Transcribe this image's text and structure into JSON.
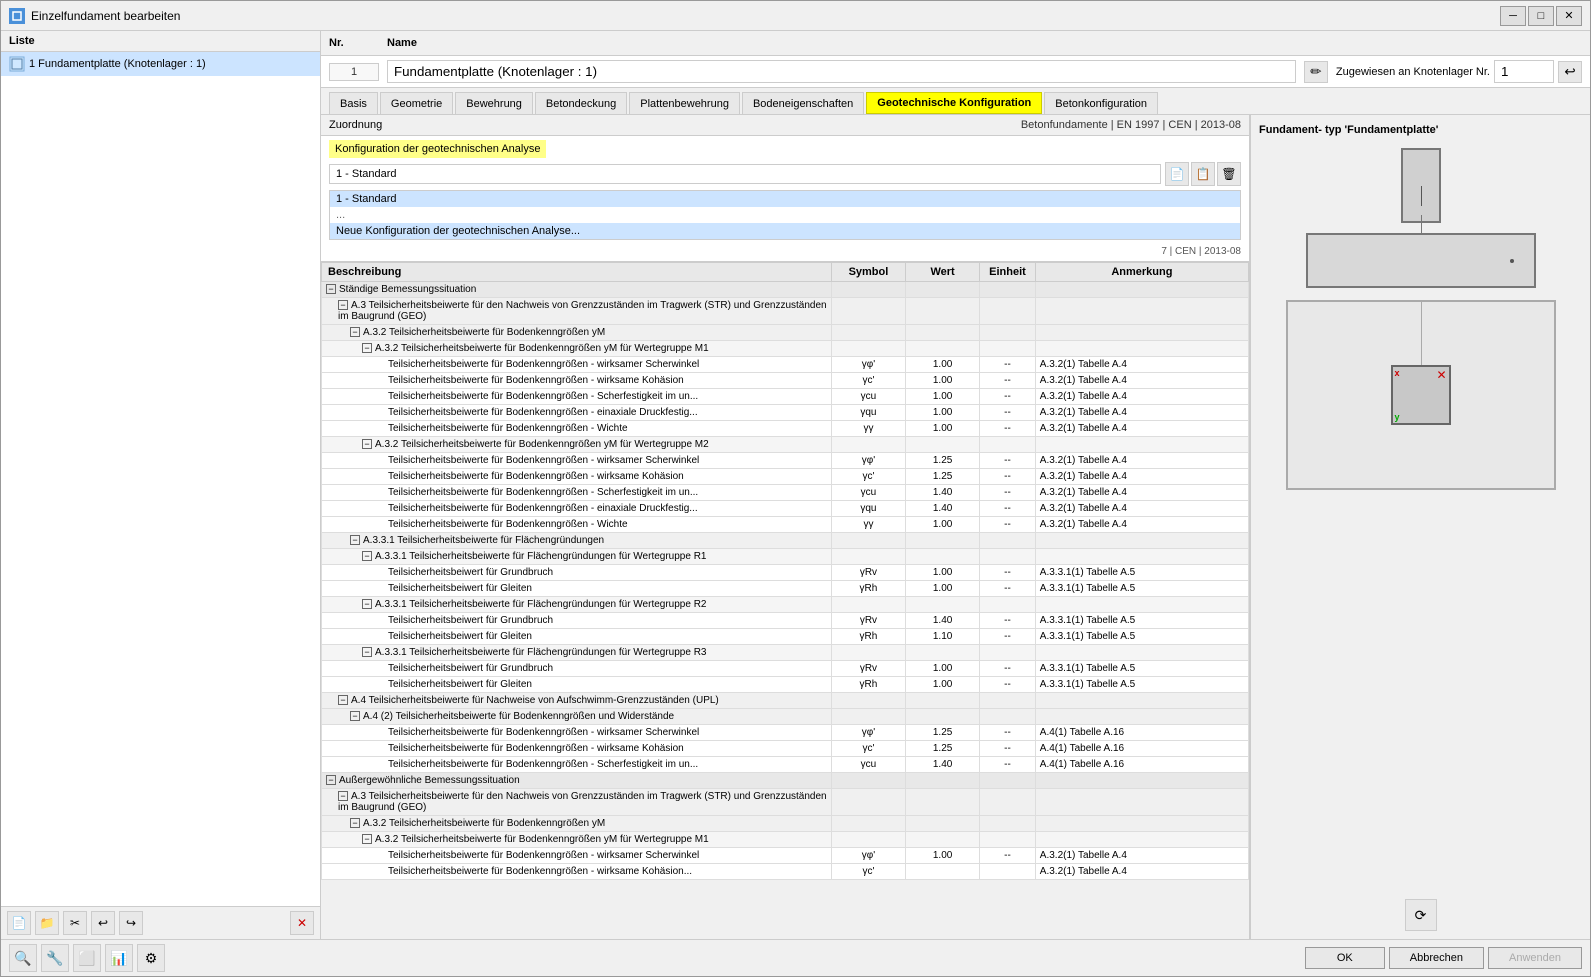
{
  "window": {
    "title": "Einzelfundament bearbeiten",
    "minimize_label": "─",
    "maximize_label": "□",
    "close_label": "✕"
  },
  "left_panel": {
    "header": "Liste",
    "items": [
      {
        "id": 1,
        "label": "1  Fundamentplatte (Knotenlager : 1)"
      }
    ],
    "footer_btns": [
      "📄",
      "📁",
      "✂",
      "↩",
      "↪"
    ],
    "delete_btn": "✕"
  },
  "header": {
    "nr_label": "Nr.",
    "name_label": "Name",
    "nr_value": "1",
    "name_value": "Fundamentplatte (Knotenlager : 1)"
  },
  "assignment": {
    "label": "Zugewiesen an Knotenlager Nr.",
    "value": "1"
  },
  "tabs": [
    {
      "id": "basis",
      "label": "Basis",
      "active": false,
      "highlight": false
    },
    {
      "id": "geometrie",
      "label": "Geometrie",
      "active": false,
      "highlight": false
    },
    {
      "id": "bewehrung",
      "label": "Bewehrung",
      "active": false,
      "highlight": false
    },
    {
      "id": "betondeckung",
      "label": "Betondeckung",
      "active": false,
      "highlight": false
    },
    {
      "id": "plattenbewehrung",
      "label": "Plattenbewehrung",
      "active": false,
      "highlight": false
    },
    {
      "id": "bodeneigenschaften",
      "label": "Bodeneigenschaften",
      "active": false,
      "highlight": false
    },
    {
      "id": "geotechnische",
      "label": "Geotechnische Konfiguration",
      "active": true,
      "highlight": true
    },
    {
      "id": "betonkonfiguration",
      "label": "Betonkonfiguration",
      "active": false,
      "highlight": false
    }
  ],
  "zuordnung": {
    "label": "Zuordnung",
    "norm_text": "Betonfundamente | EN 1997 | CEN | 2013-08"
  },
  "config": {
    "header_label": "Konfiguration der geotechnischen Analyse",
    "selected": "1 - Standard",
    "items": [
      {
        "label": "1 - Standard",
        "selected": true
      },
      {
        "label": "Neue Konfiguration der geotechnischen Analyse...",
        "is_new": true
      }
    ],
    "dots": "...",
    "norm_value": "7 | CEN | 2013-08"
  },
  "table": {
    "columns": [
      "Beschreibung",
      "Symbol",
      "Wert",
      "Einheit",
      "Anmerkung"
    ],
    "rows": [
      {
        "level": 0,
        "expand": true,
        "text": "Ständige Bemessungssituation",
        "symbol": "",
        "wert": "",
        "einheit": "",
        "anmerkung": "",
        "type": "section"
      },
      {
        "level": 1,
        "expand": true,
        "text": "A.3 Teilsicherheitsbeiwerte für den Nachweis von Grenzzuständen im Tragwerk (STR) und Grenzzuständen im Baugrund (GEO)",
        "symbol": "",
        "wert": "",
        "einheit": "",
        "anmerkung": "",
        "type": "sub"
      },
      {
        "level": 2,
        "expand": true,
        "text": "A.3.2 Teilsicherheitsbeiwerte für Bodenkenngrößen yM",
        "symbol": "",
        "wert": "",
        "einheit": "",
        "anmerkung": "",
        "type": "sub"
      },
      {
        "level": 3,
        "expand": true,
        "text": "A.3.2 Teilsicherheitsbeiwerte für Bodenkenngrößen yM für Wertegruppe M1",
        "symbol": "",
        "wert": "",
        "einheit": "",
        "anmerkung": "",
        "type": "sub"
      },
      {
        "level": 4,
        "expand": false,
        "text": "Teilsicherheitsbeiwerte für Bodenkenngrößen - wirksamer Scherwinkel",
        "symbol": "γφ'",
        "wert": "1.00",
        "einheit": "--",
        "anmerkung": "A.3.2(1) Tabelle A.4",
        "type": "data"
      },
      {
        "level": 4,
        "expand": false,
        "text": "Teilsicherheitsbeiwerte für Bodenkenngrößen - wirksame Kohäsion",
        "symbol": "γc'",
        "wert": "1.00",
        "einheit": "--",
        "anmerkung": "A.3.2(1) Tabelle A.4",
        "type": "data"
      },
      {
        "level": 4,
        "expand": false,
        "text": "Teilsicherheitsbeiwerte für Bodenkenngrößen - Scherfestigkeit im un...",
        "symbol": "γcu",
        "wert": "1.00",
        "einheit": "--",
        "anmerkung": "A.3.2(1) Tabelle A.4",
        "type": "data"
      },
      {
        "level": 4,
        "expand": false,
        "text": "Teilsicherheitsbeiwerte für Bodenkenngrößen - einaxiale Druckfestig...",
        "symbol": "γqu",
        "wert": "1.00",
        "einheit": "--",
        "anmerkung": "A.3.2(1) Tabelle A.4",
        "type": "data"
      },
      {
        "level": 4,
        "expand": false,
        "text": "Teilsicherheitsbeiwerte für Bodenkenngrößen - Wichte",
        "symbol": "γγ",
        "wert": "1.00",
        "einheit": "--",
        "anmerkung": "A.3.2(1) Tabelle A.4",
        "type": "data"
      },
      {
        "level": 3,
        "expand": true,
        "text": "A.3.2 Teilsicherheitsbeiwerte für Bodenkenngrößen yM für Wertegruppe M2",
        "symbol": "",
        "wert": "",
        "einheit": "",
        "anmerkung": "",
        "type": "sub"
      },
      {
        "level": 4,
        "expand": false,
        "text": "Teilsicherheitsbeiwerte für Bodenkenngrößen - wirksamer Scherwinkel",
        "symbol": "γφ'",
        "wert": "1.25",
        "einheit": "--",
        "anmerkung": "A.3.2(1) Tabelle A.4",
        "type": "data"
      },
      {
        "level": 4,
        "expand": false,
        "text": "Teilsicherheitsbeiwerte für Bodenkenngrößen - wirksame Kohäsion",
        "symbol": "γc'",
        "wert": "1.25",
        "einheit": "--",
        "anmerkung": "A.3.2(1) Tabelle A.4",
        "type": "data"
      },
      {
        "level": 4,
        "expand": false,
        "text": "Teilsicherheitsbeiwerte für Bodenkenngrößen - Scherfestigkeit im un...",
        "symbol": "γcu",
        "wert": "1.40",
        "einheit": "--",
        "anmerkung": "A.3.2(1) Tabelle A.4",
        "type": "data"
      },
      {
        "level": 4,
        "expand": false,
        "text": "Teilsicherheitsbeiwerte für Bodenkenngrößen - einaxiale Druckfestig...",
        "symbol": "γqu",
        "wert": "1.40",
        "einheit": "--",
        "anmerkung": "A.3.2(1) Tabelle A.4",
        "type": "data"
      },
      {
        "level": 4,
        "expand": false,
        "text": "Teilsicherheitsbeiwerte für Bodenkenngrößen - Wichte",
        "symbol": "γγ",
        "wert": "1.00",
        "einheit": "--",
        "anmerkung": "A.3.2(1) Tabelle A.4",
        "type": "data"
      },
      {
        "level": 2,
        "expand": true,
        "text": "A.3.3.1 Teilsicherheitsbeiwerte für Flächengründungen",
        "symbol": "",
        "wert": "",
        "einheit": "",
        "anmerkung": "",
        "type": "sub"
      },
      {
        "level": 3,
        "expand": true,
        "text": "A.3.3.1 Teilsicherheitsbeiwerte für Flächengründungen für Wertegruppe R1",
        "symbol": "",
        "wert": "",
        "einheit": "",
        "anmerkung": "",
        "type": "sub"
      },
      {
        "level": 4,
        "expand": false,
        "text": "Teilsicherheitsbeiwert für Grundbruch",
        "symbol": "γRv",
        "wert": "1.00",
        "einheit": "--",
        "anmerkung": "A.3.3.1(1) Tabelle A.5",
        "type": "data"
      },
      {
        "level": 4,
        "expand": false,
        "text": "Teilsicherheitsbeiwert für Gleiten",
        "symbol": "γRh",
        "wert": "1.00",
        "einheit": "--",
        "anmerkung": "A.3.3.1(1) Tabelle A.5",
        "type": "data"
      },
      {
        "level": 3,
        "expand": true,
        "text": "A.3.3.1 Teilsicherheitsbeiwerte für Flächengründungen für Wertegruppe R2",
        "symbol": "",
        "wert": "",
        "einheit": "",
        "anmerkung": "",
        "type": "sub"
      },
      {
        "level": 4,
        "expand": false,
        "text": "Teilsicherheitsbeiwert für Grundbruch",
        "symbol": "γRv",
        "wert": "1.40",
        "einheit": "--",
        "anmerkung": "A.3.3.1(1) Tabelle A.5",
        "type": "data"
      },
      {
        "level": 4,
        "expand": false,
        "text": "Teilsicherheitsbeiwert für Gleiten",
        "symbol": "γRh",
        "wert": "1.10",
        "einheit": "--",
        "anmerkung": "A.3.3.1(1) Tabelle A.5",
        "type": "data"
      },
      {
        "level": 3,
        "expand": true,
        "text": "A.3.3.1 Teilsicherheitsbeiwerte für Flächengründungen für Wertegruppe R3",
        "symbol": "",
        "wert": "",
        "einheit": "",
        "anmerkung": "",
        "type": "sub"
      },
      {
        "level": 4,
        "expand": false,
        "text": "Teilsicherheitsbeiwert für Grundbruch",
        "symbol": "γRv",
        "wert": "1.00",
        "einheit": "--",
        "anmerkung": "A.3.3.1(1) Tabelle A.5",
        "type": "data"
      },
      {
        "level": 4,
        "expand": false,
        "text": "Teilsicherheitsbeiwert für Gleiten",
        "symbol": "γRh",
        "wert": "1.00",
        "einheit": "--",
        "anmerkung": "A.3.3.1(1) Tabelle A.5",
        "type": "data"
      },
      {
        "level": 1,
        "expand": true,
        "text": "A.4 Teilsicherheitsbeiwerte für Nachweise von Aufschwimm-Grenzzuständen (UPL)",
        "symbol": "",
        "wert": "",
        "einheit": "",
        "anmerkung": "",
        "type": "sub"
      },
      {
        "level": 2,
        "expand": true,
        "text": "A.4 (2) Teilsicherheitsbeiwerte für Bodenkenngrößen und Widerstände",
        "symbol": "",
        "wert": "",
        "einheit": "",
        "anmerkung": "",
        "type": "sub"
      },
      {
        "level": 4,
        "expand": false,
        "text": "Teilsicherheitsbeiwerte für Bodenkenngrößen - wirksamer Scherwinkel",
        "symbol": "γφ'",
        "wert": "1.25",
        "einheit": "--",
        "anmerkung": "A.4(1) Tabelle A.16",
        "type": "data"
      },
      {
        "level": 4,
        "expand": false,
        "text": "Teilsicherheitsbeiwerte für Bodenkenngrößen - wirksame Kohäsion",
        "symbol": "γc'",
        "wert": "1.25",
        "einheit": "--",
        "anmerkung": "A.4(1) Tabelle A.16",
        "type": "data"
      },
      {
        "level": 4,
        "expand": false,
        "text": "Teilsicherheitsbeiwerte für Bodenkenngrößen - Scherfestigkeit im un...",
        "symbol": "γcu",
        "wert": "1.40",
        "einheit": "--",
        "anmerkung": "A.4(1) Tabelle A.16",
        "type": "data"
      },
      {
        "level": 0,
        "expand": true,
        "text": "Außergewöhnliche Bemessungssituation",
        "symbol": "",
        "wert": "",
        "einheit": "",
        "anmerkung": "",
        "type": "section"
      },
      {
        "level": 1,
        "expand": true,
        "text": "A.3 Teilsicherheitsbeiwerte für den Nachweis von Grenzzuständen im Tragwerk (STR) und Grenzzuständen im Baugrund (GEO)",
        "symbol": "",
        "wert": "",
        "einheit": "",
        "anmerkung": "",
        "type": "sub"
      },
      {
        "level": 2,
        "expand": true,
        "text": "A.3.2 Teilsicherheitsbeiwerte für Bodenkenngrößen yM",
        "symbol": "",
        "wert": "",
        "einheit": "",
        "anmerkung": "",
        "type": "sub"
      },
      {
        "level": 3,
        "expand": true,
        "text": "A.3.2 Teilsicherheitsbeiwerte für Bodenkenngrößen yM für Wertegruppe M1",
        "symbol": "",
        "wert": "",
        "einheit": "",
        "anmerkung": "",
        "type": "sub"
      },
      {
        "level": 4,
        "expand": false,
        "text": "Teilsicherheitsbeiwerte für Bodenkenngrößen - wirksamer Scherwinkel",
        "symbol": "γφ'",
        "wert": "1.00",
        "einheit": "--",
        "anmerkung": "A.3.2(1) Tabelle A.4",
        "type": "data"
      },
      {
        "level": 4,
        "expand": false,
        "text": "Teilsicherheitsbeiwerte für Bodenkenngrößen - wirksame Kohäsion...",
        "symbol": "γc'",
        "wert": "",
        "einheit": "",
        "anmerkung": "A.3.2(1) Tabelle A.4",
        "type": "data"
      }
    ]
  },
  "preview": {
    "title": "Fundament-\ntyp 'Fundamentplatte'"
  },
  "footer": {
    "ok_label": "OK",
    "cancel_label": "Abbrechen",
    "apply_label": "Anwenden"
  },
  "bottom_toolbar": {
    "buttons": [
      "🔍",
      "🔧",
      "⬜",
      "📊",
      "⚙"
    ]
  }
}
